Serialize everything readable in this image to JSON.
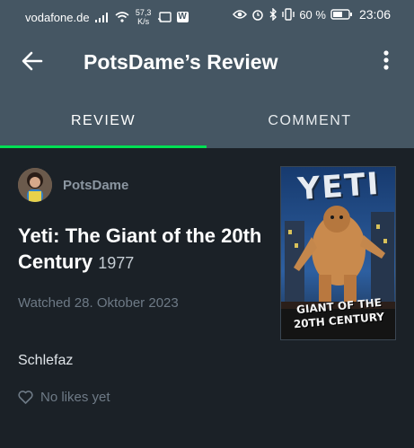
{
  "status_bar": {
    "carrier": "vodafone.de",
    "speed_value": "57,3",
    "speed_unit": "K/s",
    "badge": "W",
    "battery_percent": "60 %",
    "time": "23:06",
    "icons": [
      "signal-icon",
      "wifi-icon",
      "cast-icon",
      "w-app-icon",
      "eye-icon",
      "alarm-icon",
      "bluetooth-icon",
      "vibrate-icon",
      "battery-icon"
    ]
  },
  "app_bar": {
    "title": "PotsDame’s Review",
    "back_icon": "arrow-back-icon",
    "menu_icon": "more-vert-icon"
  },
  "tabs": [
    {
      "label": "REVIEW",
      "selected": true
    },
    {
      "label": "COMMENT",
      "selected": false
    }
  ],
  "colors": {
    "header_bg": "#455663",
    "body_bg": "#1b2127",
    "accent_green": "#00e054"
  },
  "review": {
    "username": "PotsDame",
    "film_title": "Yeti: The Giant of the 20th Century",
    "film_year": "1977",
    "watched": "Watched 28. Oktober 2023",
    "text": "Schlefaz",
    "likes": "No likes yet"
  },
  "poster": {
    "title_top": "YETI",
    "title_bottom_1": "GIANT OF THE",
    "title_bottom_2": "20TH CENTURY"
  }
}
